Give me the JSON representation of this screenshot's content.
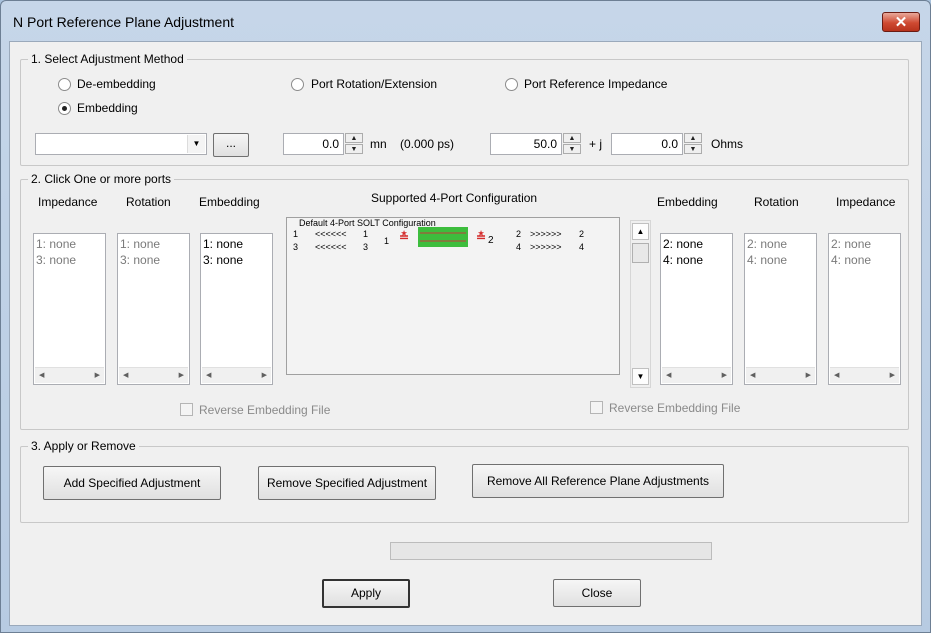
{
  "window": {
    "title": "N Port Reference Plane Adjustment",
    "close_glyph": "✕"
  },
  "method": {
    "legend": "1. Select Adjustment Method",
    "options": [
      "De-embedding",
      "Port Rotation/Extension",
      "Port Reference Impedance",
      "Embedding"
    ],
    "selected": "Embedding",
    "file_combo_value": "",
    "browse_label": "...",
    "rotation_value": "0.0",
    "rotation_unit": "mn",
    "rotation_ps": "(0.000 ps)",
    "impedance_real": "50.0",
    "plus_j": "+ j",
    "impedance_imag": "0.0",
    "impedance_unit": "Ohms"
  },
  "ports": {
    "legend": "2. Click One or more ports",
    "left_headers": [
      "Impedance",
      "Rotation",
      "Embedding"
    ],
    "right_headers": [
      "Embedding",
      "Rotation",
      "Impedance"
    ],
    "left_lists": [
      {
        "items": [
          "1: none",
          "3: none"
        ],
        "dim": true
      },
      {
        "items": [
          "1: none",
          "3: none"
        ],
        "dim": true
      },
      {
        "items": [
          "1: none",
          "3: none"
        ],
        "dim": false
      }
    ],
    "right_lists": [
      {
        "items": [
          "2: none",
          "4: none"
        ],
        "dim": false
      },
      {
        "items": [
          "2: none",
          "4: none"
        ],
        "dim": true
      },
      {
        "items": [
          "2: none",
          "4: none"
        ],
        "dim": true
      }
    ],
    "config_title": "Supported 4-Port Configuration",
    "diagram": {
      "caption": "Default 4-Port SOLT Configuration",
      "left_rows": [
        {
          "port": "1",
          "arrows": "<<<<<<",
          "dut": "1"
        },
        {
          "port": "3",
          "arrows": "<<<<<<",
          "dut": "3"
        }
      ],
      "right_rows": [
        {
          "dut": "2",
          "arrows": ">>>>>>",
          "port": "2"
        },
        {
          "dut": "4",
          "arrows": ">>>>>>",
          "port": "4"
        }
      ],
      "left_dut_label": "1",
      "right_dut_label": "2"
    },
    "reverse_label": "Reverse Embedding File"
  },
  "apply_remove": {
    "legend": "3. Apply or Remove",
    "add": "Add Specified Adjustment",
    "remove": "Remove Specified Adjustment",
    "remove_all": "Remove All Reference Plane Adjustments"
  },
  "footer": {
    "apply": "Apply",
    "close": "Close"
  }
}
